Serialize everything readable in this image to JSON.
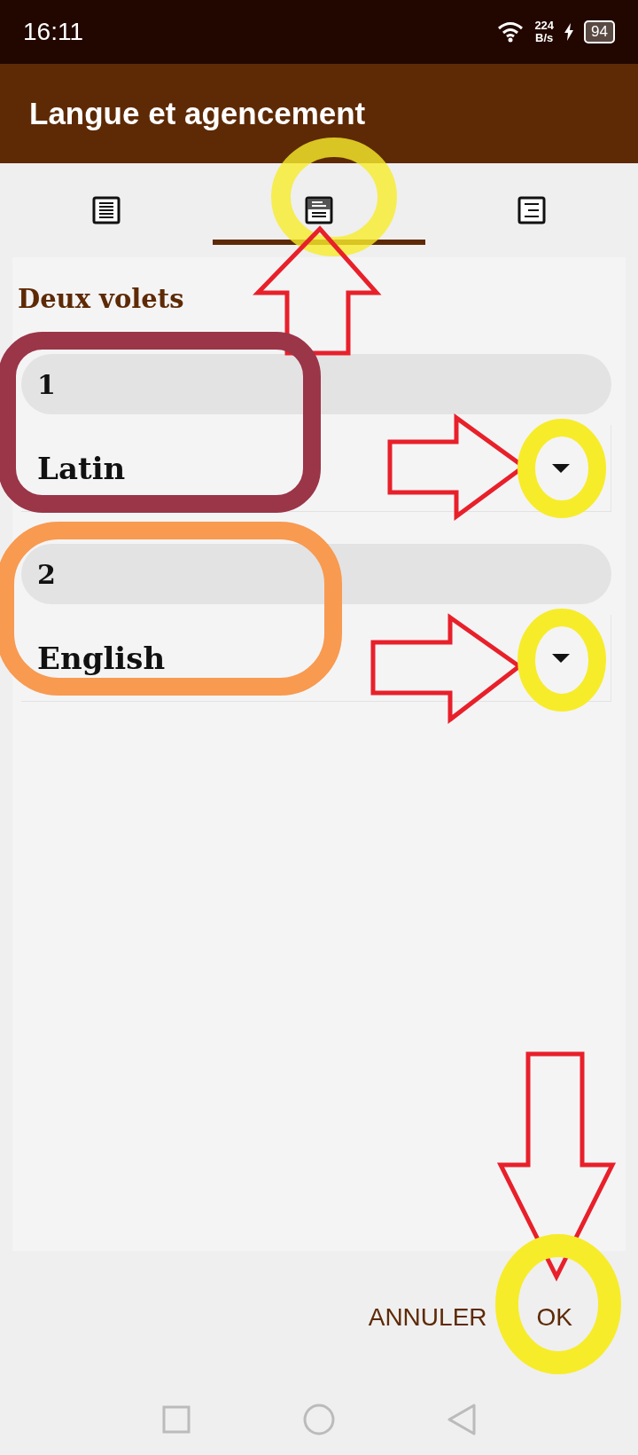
{
  "status_bar": {
    "time": "16:11",
    "speed_value": "224",
    "speed_unit": "B/s",
    "battery": "94"
  },
  "app_bar": {
    "title": "Langue et agencement"
  },
  "tabs": [
    {
      "kind": "single",
      "selected": false
    },
    {
      "kind": "split",
      "selected": true
    },
    {
      "kind": "side",
      "selected": false
    }
  ],
  "section": {
    "title": "Deux volets"
  },
  "panes": [
    {
      "number": "1",
      "language": "Latin"
    },
    {
      "number": "2",
      "language": "English"
    }
  ],
  "buttons": [
    {
      "label": "ANNULER"
    },
    {
      "label": "OK"
    }
  ]
}
